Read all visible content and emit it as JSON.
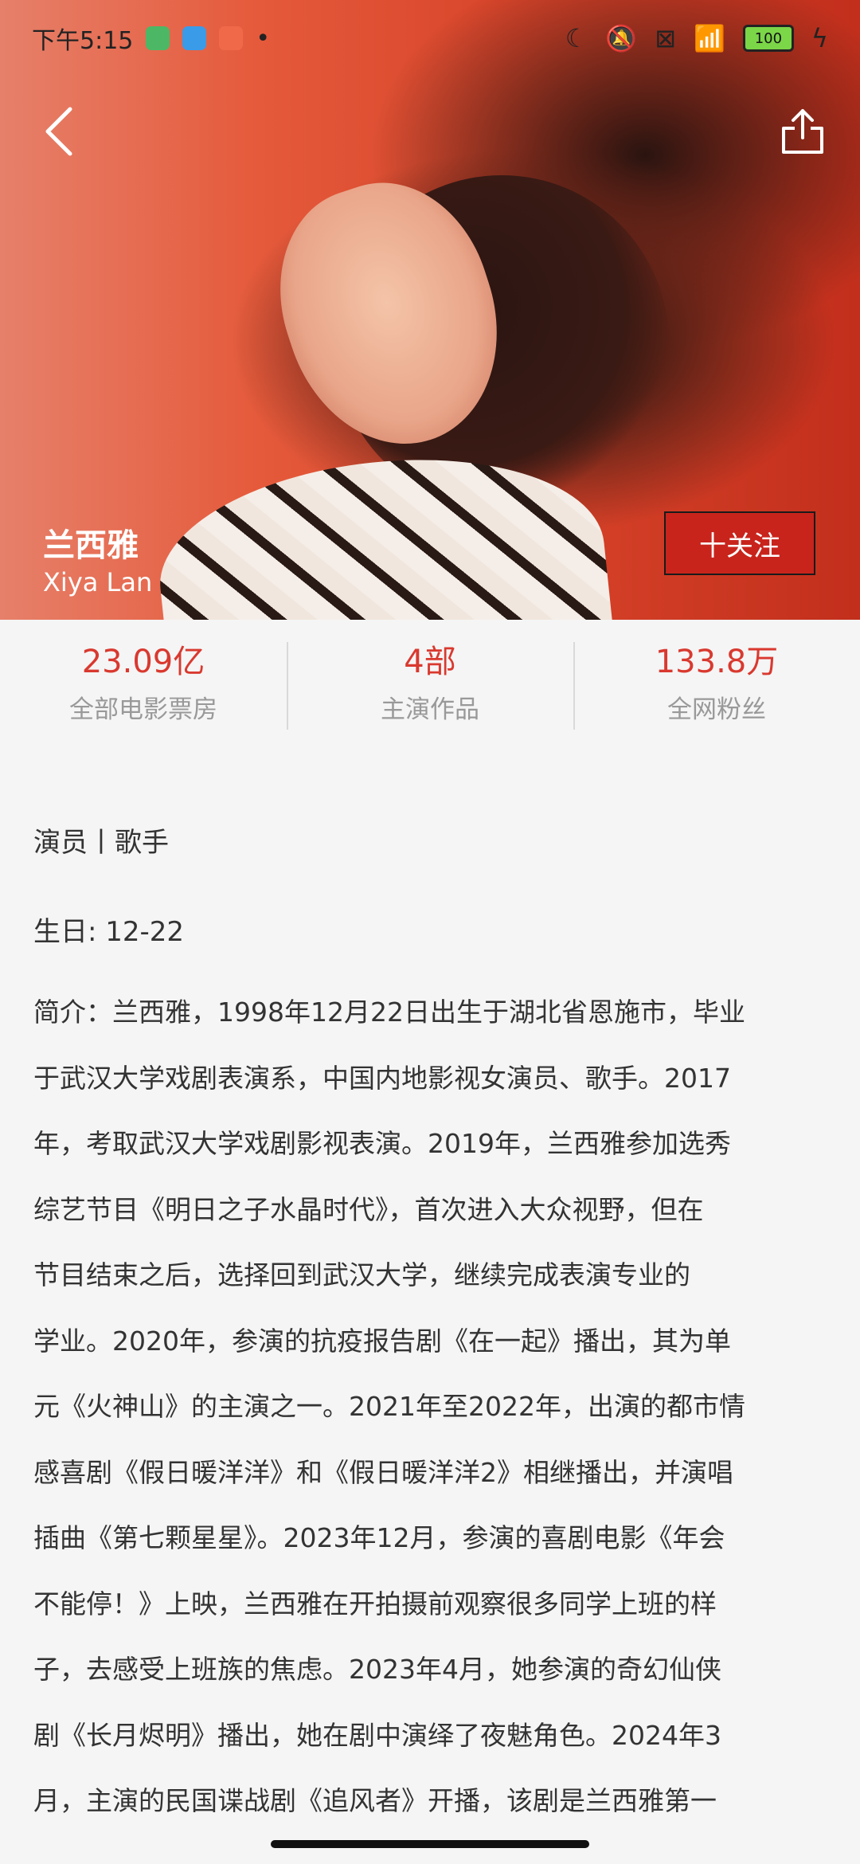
{
  "status_bar": {
    "time": "下午5:15",
    "battery": "100"
  },
  "profile": {
    "name_cn": "兰西雅",
    "name_en": "Xiya Lan",
    "follow_label": "十关注"
  },
  "stats": [
    {
      "value": "23.09亿",
      "label": "全部电影票房"
    },
    {
      "value": "4部",
      "label": "主演作品"
    },
    {
      "value": "133.8万",
      "label": "全网粉丝"
    }
  ],
  "info": {
    "role": "演员丨歌手",
    "birthday": "生日: 12-22"
  },
  "bio_lines": [
    "简介：兰西雅，1998年12月22日出生于湖北省恩施市，毕业",
    "于武汉大学戏剧表演系，中国内地影视女演员、歌手。2017",
    "年，考取武汉大学戏剧影视表演。2019年，兰西雅参加选秀",
    "综艺节目《明日之子水晶时代》，首次进入大众视野，但在",
    "节目结束之后，选择回到武汉大学，继续完成表演专业的",
    "学业。2020年，参演的抗疫报告剧《在一起》播出，其为单",
    "元《火神山》的主演之一。2021年至2022年，出演的都市情",
    "感喜剧《假日暖洋洋》和《假日暖洋洋2》相继播出，并演唱",
    "插曲《第七颗星星》。2023年12月，参演的喜剧电影《年会",
    "不能停！》上映，兰西雅在开拍摄前观察很多同学上班的样",
    "子，去感受上班族的焦虑。2023年4月，她参演的奇幻仙侠",
    "剧《长月烬明》播出，她在剧中演绎了夜魅角色。2024年3",
    "月，主演的民国谍战剧《追风者》开播，该剧是兰西雅第一"
  ]
}
